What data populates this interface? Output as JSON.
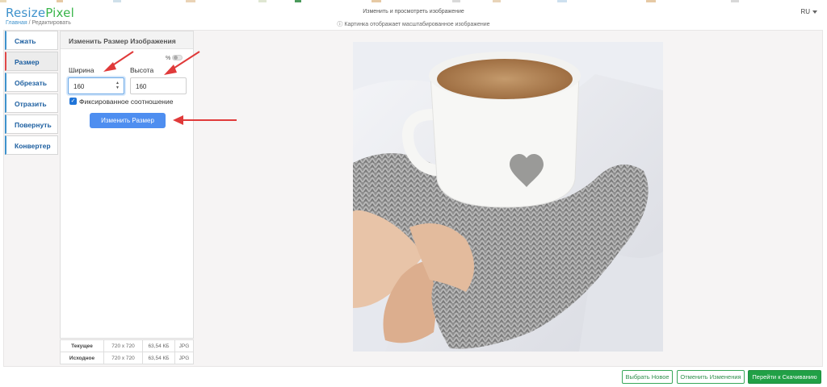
{
  "header": {
    "logo_part1": "Resize",
    "logo_part2": "Pixel",
    "breadcrumb_home": "Главная",
    "breadcrumb_sep": " / ",
    "breadcrumb_current": "Редактировать",
    "title": "Изменить и просмотреть изображение",
    "subtitle": "ⓘ Картинка отображает масштабированное изображение",
    "language": "RU"
  },
  "sidebar": {
    "items": [
      {
        "label": "Сжать"
      },
      {
        "label": "Размер"
      },
      {
        "label": "Обрезать"
      },
      {
        "label": "Отразить"
      },
      {
        "label": "Повернуть"
      },
      {
        "label": "Конвертер"
      }
    ]
  },
  "panel": {
    "title": "Изменить Размер Изображения",
    "percent_label": "%",
    "width_label": "Ширина",
    "height_label": "Высота",
    "width_value": "160",
    "height_value": "160",
    "lock_ratio_label": "Фиксированное соотношение",
    "resize_button": "Изменить Размер"
  },
  "info_table": {
    "rows": [
      {
        "label": "Текущее",
        "dims": "720 x 720",
        "size": "63,54 КБ",
        "format": "JPG"
      },
      {
        "label": "Исходное",
        "dims": "720 x 720",
        "size": "63,54 КБ",
        "format": "JPG"
      }
    ]
  },
  "footer": {
    "choose_new": "Выбрать Новое",
    "cancel_changes": "Отменить Изменения",
    "go_download": "Перейти к Скачиванию"
  },
  "colors": {
    "brand_blue": "#3e92cc",
    "brand_green": "#39b54a",
    "primary_button": "#4e8ef0",
    "download_button": "#21a046",
    "arrow": "#e03a3a"
  }
}
